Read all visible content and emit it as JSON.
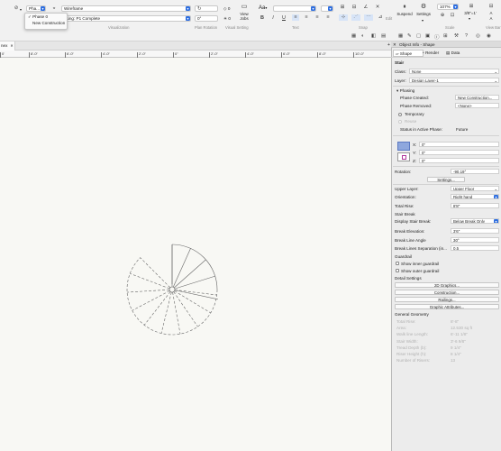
{
  "ribbon": {
    "phase_value": "Pha...",
    "render_mode": "Wireframe",
    "phase_complete": "asing: P1 Complete",
    "rotation": "0°",
    "view_angle": "0",
    "view_jobs": "View Jobs",
    "visualization_label": "Visualization",
    "plan_rotation_label": "Plan Rotation",
    "visual_setting_label": "Visual Setting",
    "text_label": "Text",
    "font_size": "Aa",
    "suspend_label": "Suspend",
    "settings_label": "Settings",
    "zoom": "107%",
    "scale": "3/8\"=1'",
    "scale_label": "Scale",
    "snap_label": "Snap",
    "view_bar_label": "View Bar",
    "edit_label": "Edit",
    "a_label": "A",
    "a2_label": "A"
  },
  "phase_menu": {
    "items": [
      {
        "label": "Phase 0",
        "checked": true
      },
      {
        "label": "New Construction",
        "checked": false
      }
    ]
  },
  "tab": {
    "label": "nex"
  },
  "ruler": {
    "labels": [
      "0'",
      "8'-0\"",
      "6'-0\"",
      "4'-0\"",
      "2'-0\"",
      "0\"",
      "2'-0\"",
      "4'-0\"",
      "6'-0\"",
      "8'-0\"",
      "10'-0\""
    ]
  },
  "panel": {
    "title": "Object Info - Shape",
    "tabs": [
      "Shape",
      "Render",
      "Data"
    ],
    "object_type": "Stair",
    "class_label": "Class:",
    "class_value": "None",
    "layer_label": "Layer:",
    "layer_value": "Design Layer-1",
    "phasing_label": "Phasing",
    "phase_created_label": "Phase Created:",
    "phase_created_value": "New Construction...",
    "phase_removed_label": "Phase Removed:",
    "phase_removed_value": "<None>",
    "temporary_label": "Temporary",
    "reuse_label": "Reuse",
    "status_label": "Status in Active Phase:",
    "status_value": "Future",
    "x_label": "X:",
    "x_value": "0\"",
    "y_label": "Y:",
    "y_value": "0\"",
    "z_label": "Z:",
    "z_value": "0\"",
    "rotation_label": "Rotation:",
    "rotation_value": "-90.19°",
    "settings_button": "Settings...",
    "upper_layer_label": "Upper Layer:",
    "upper_layer_value": "Upper Floor",
    "orientation_label": "Orientation:",
    "orientation_value": "Right hand",
    "total_rise_label": "Total Rise:",
    "total_rise_value": "8'8\"",
    "stair_break_label": "Stair Break",
    "display_break_label": "Display Stair Break:",
    "display_break_value": "Below Break Only",
    "break_elevation_label": "Break Elevation:",
    "break_elevation_value": "3'6\"",
    "break_angle_label": "Break Line Angle",
    "break_angle_value": "30°",
    "break_separation_label": "Break Lines Separation (in...",
    "break_separation_value": "0.5",
    "guardrail_label": "Guardrail",
    "inner_guardrail_label": "Show inner guardrail",
    "outer_guardrail_label": "Show outer guardrail",
    "detail_settings_label": "Detail Settings",
    "graphics_2d_button": "2D Graphics...",
    "construction_button": "Construction...",
    "railings_button": "Railings...",
    "graphic_attributes_button": "Graphic Attributes...",
    "general_geometry_label": "General Geometry",
    "geometry_rows": [
      {
        "label": "Total Rise:",
        "value": "8'-8\""
      },
      {
        "label": "Area:",
        "value": "12.530 sq ft"
      },
      {
        "label": "Walk line Length:",
        "value": "6'-11 1/8\""
      },
      {
        "label": "Stair Width:",
        "value": "3'-6 9/8\""
      },
      {
        "label": "Tread Depth (b):",
        "value": "9 1/4\""
      },
      {
        "label": "Riser Height (h):",
        "value": "8 1/4\""
      },
      {
        "label": "Number of Risers:",
        "value": "13"
      }
    ]
  }
}
